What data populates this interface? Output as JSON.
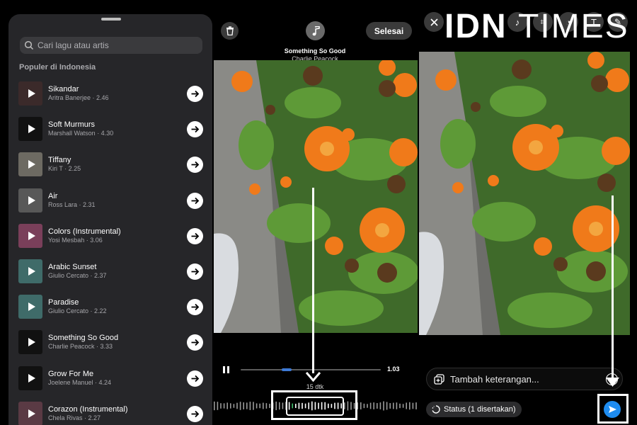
{
  "picker": {
    "search_placeholder": "Cari lagu atau artis",
    "section_title": "Populer di Indonesia",
    "songs": [
      {
        "title": "Sikandar",
        "meta": "Aritra Banerjee · 2.46",
        "thumb": "#3b2a2a"
      },
      {
        "title": "Soft Murmurs",
        "meta": "Marshall Watson · 4.30",
        "thumb": "#111111"
      },
      {
        "title": "Tiffany",
        "meta": "Kiri T · 2.25",
        "thumb": "#6d6a62"
      },
      {
        "title": "Air",
        "meta": "Ross Lara · 2.31",
        "thumb": "#585858"
      },
      {
        "title": "Colors (Instrumental)",
        "meta": "Yosi Mesbah · 3.06",
        "thumb": "#7a3f5a"
      },
      {
        "title": "Arabic Sunset",
        "meta": "Giulio Cercato · 2.37",
        "thumb": "#3f6b69"
      },
      {
        "title": "Paradise",
        "meta": "Giulio Cercato · 2.22",
        "thumb": "#3f6b69"
      },
      {
        "title": "Something So Good",
        "meta": "Charlie Peacock · 3.33",
        "thumb": "#111111"
      },
      {
        "title": "Grow For Me",
        "meta": "Joelene Manuel · 4.24",
        "thumb": "#111111"
      },
      {
        "title": "Corazon (Instrumental)",
        "meta": "Chela Rivas · 2.27",
        "thumb": "#5a3a44"
      }
    ]
  },
  "editor": {
    "done_label": "Selesai",
    "now_playing_title": "Something So Good",
    "now_playing_artist": "Charlie Peacock",
    "elapsed": "1.03",
    "duration_label": "15 dtk",
    "progress_fraction": 0.3
  },
  "share": {
    "caption_placeholder": "Tambah keterangan...",
    "status_label": "Status (1 disertakan)"
  },
  "watermark": {
    "bold": "IDN",
    "thin": "TIMES"
  },
  "colors": {
    "accent": "#1e8cf0",
    "sheet": "#262629"
  },
  "icons": [
    "search-icon",
    "arrow-right-icon",
    "trash-icon",
    "music-note-icon",
    "pause-icon",
    "close-icon",
    "add-caption-icon",
    "status-icon",
    "send-icon",
    "view-once-icon"
  ]
}
